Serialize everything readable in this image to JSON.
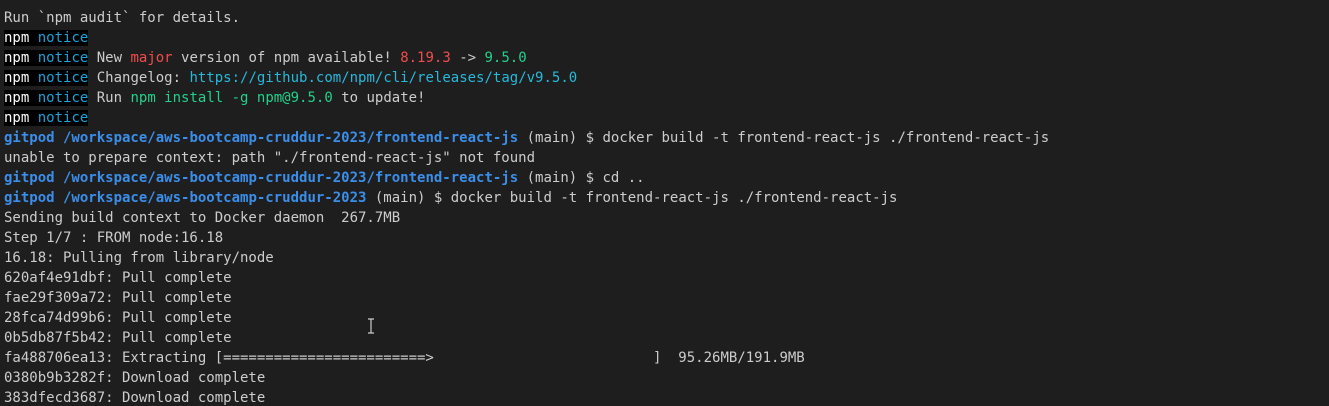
{
  "terminal": {
    "lines": [
      {
        "segments": [
          {
            "text": "Run `npm audit` for details.",
            "cls": ""
          }
        ]
      },
      {
        "segments": [
          {
            "text": "npm",
            "cls": "npm"
          },
          {
            "text": " notice",
            "cls": "notice"
          }
        ]
      },
      {
        "segments": [
          {
            "text": "npm",
            "cls": "npm"
          },
          {
            "text": " notice",
            "cls": "notice"
          },
          {
            "text": " New ",
            "cls": ""
          },
          {
            "text": "major",
            "cls": "major"
          },
          {
            "text": " version of npm available! ",
            "cls": ""
          },
          {
            "text": "8.19.3",
            "cls": "old"
          },
          {
            "text": " -> ",
            "cls": ""
          },
          {
            "text": "9.5.0",
            "cls": "new"
          }
        ]
      },
      {
        "segments": [
          {
            "text": "npm",
            "cls": "npm"
          },
          {
            "text": " notice",
            "cls": "notice"
          },
          {
            "text": " Changelog: ",
            "cls": ""
          },
          {
            "text": "https://github.com/npm/cli/releases/tag/v9.5.0",
            "cls": "link"
          }
        ]
      },
      {
        "segments": [
          {
            "text": "npm",
            "cls": "npm"
          },
          {
            "text": " notice",
            "cls": "notice"
          },
          {
            "text": " Run ",
            "cls": ""
          },
          {
            "text": "npm install -g npm@9.5.0",
            "cls": "cmd"
          },
          {
            "text": " to update!",
            "cls": ""
          }
        ]
      },
      {
        "segments": [
          {
            "text": "npm",
            "cls": "npm"
          },
          {
            "text": " notice",
            "cls": "notice"
          }
        ]
      },
      {
        "segments": [
          {
            "text": "gitpod",
            "cls": "user"
          },
          {
            "text": " /workspace/aws-bootcamp-cruddur-2023/frontend-react-js",
            "cls": "path"
          },
          {
            "text": " (main) $ docker build -t frontend-react-js ./frontend-react-js",
            "cls": ""
          }
        ]
      },
      {
        "segments": [
          {
            "text": "unable to prepare context: path \"./frontend-react-js\" not found",
            "cls": ""
          }
        ]
      },
      {
        "segments": [
          {
            "text": "gitpod",
            "cls": "user"
          },
          {
            "text": " /workspace/aws-bootcamp-cruddur-2023/frontend-react-js",
            "cls": "path"
          },
          {
            "text": " (main) $ cd ..",
            "cls": ""
          }
        ]
      },
      {
        "segments": [
          {
            "text": "gitpod",
            "cls": "user"
          },
          {
            "text": " /workspace/aws-bootcamp-cruddur-2023",
            "cls": "path"
          },
          {
            "text": " (main) $ docker build -t frontend-react-js ./frontend-react-js",
            "cls": ""
          }
        ]
      },
      {
        "segments": [
          {
            "text": "Sending build context to Docker daemon  267.7MB",
            "cls": ""
          }
        ]
      },
      {
        "segments": [
          {
            "text": "Step 1/7 : FROM node:16.18",
            "cls": ""
          }
        ]
      },
      {
        "segments": [
          {
            "text": "16.18: Pulling from library/node",
            "cls": ""
          }
        ]
      },
      {
        "segments": [
          {
            "text": "620af4e91dbf: Pull complete",
            "cls": ""
          }
        ]
      },
      {
        "segments": [
          {
            "text": "fae29f309a72: Pull complete",
            "cls": ""
          }
        ]
      },
      {
        "segments": [
          {
            "text": "28fca74d99b6: Pull complete",
            "cls": ""
          }
        ]
      },
      {
        "segments": [
          {
            "text": "0b5db87f5b42: Pull complete",
            "cls": ""
          }
        ]
      },
      {
        "segments": [
          {
            "text": "fa488706ea13: Extracting [========================>                          ]  95.26MB/191.9MB",
            "cls": ""
          }
        ]
      },
      {
        "segments": [
          {
            "text": "0380b9b3282f: Download complete",
            "cls": ""
          }
        ]
      },
      {
        "segments": [
          {
            "text": "383dfecd3687: Download complete",
            "cls": ""
          }
        ]
      }
    ]
  }
}
